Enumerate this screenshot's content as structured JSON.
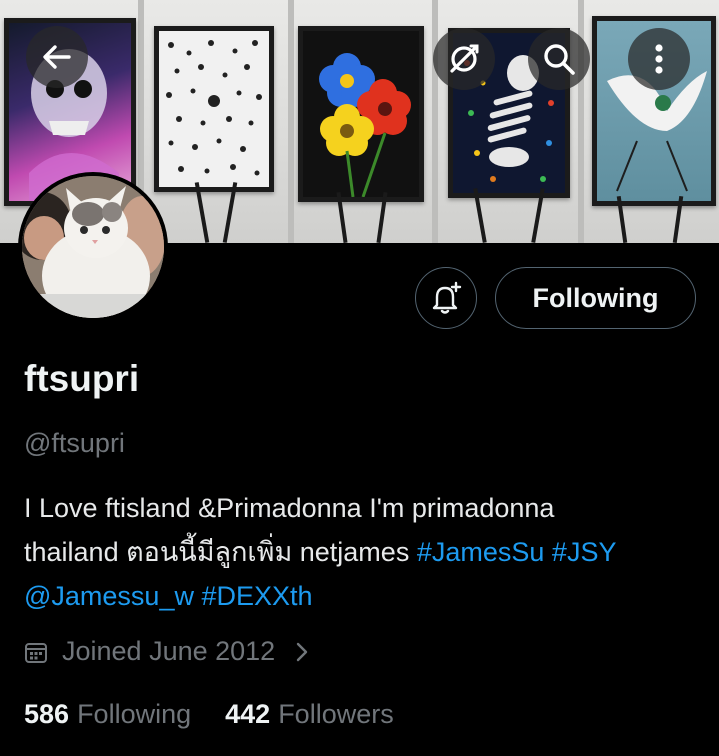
{
  "header": {
    "back_icon": "arrow-left-icon",
    "offline_icon": "no-sync-icon",
    "search_icon": "search-icon",
    "more_icon": "more-vertical-icon"
  },
  "profile": {
    "display_name": "ftsupri",
    "handle": "@ftsupri",
    "bio_line1": "I Love ftisland &Primadonna I'm primadonna",
    "bio_line2_text": "thailand  ตอนนี้มีลูกเพิ่ม netjames ",
    "bio_tag_jamessu": "#JamesSu",
    "bio_tag_jsy": "#JSY",
    "bio_mention": "@Jamessu_w",
    "bio_tag_dexxth": "#DEXXth",
    "joined": "Joined June 2012"
  },
  "actions": {
    "follow_label": "Following",
    "notify_icon": "bell-plus-icon"
  },
  "stats": {
    "following_count": "586",
    "following_label": "Following",
    "followers_count": "442",
    "followers_label": "Followers"
  },
  "colors": {
    "link": "#1d9bf0",
    "muted": "#71767b",
    "background": "#000000"
  }
}
